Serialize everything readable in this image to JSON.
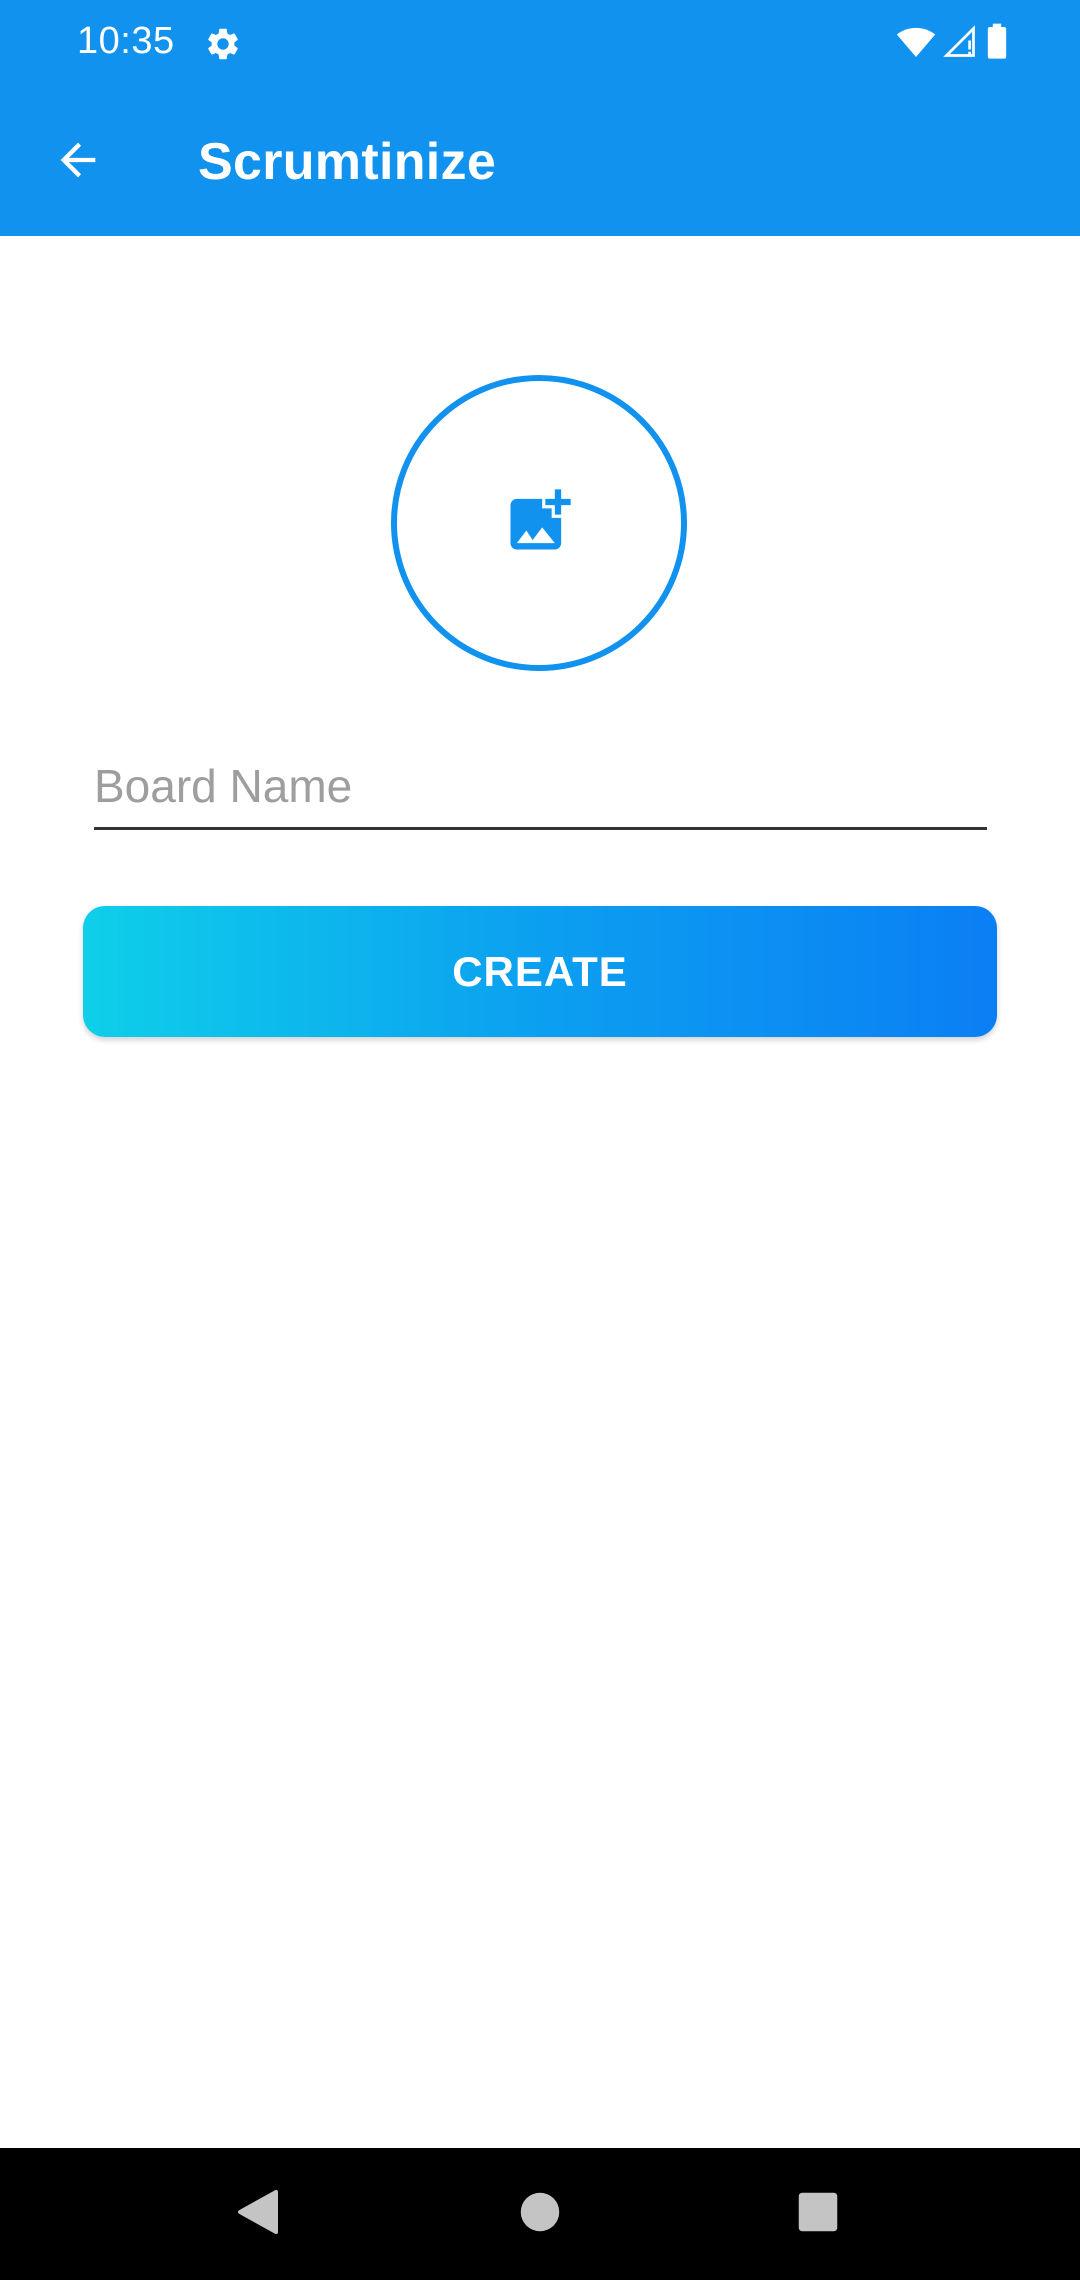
{
  "status_bar": {
    "time": "10:35",
    "icons": [
      "settings-gear-icon",
      "wifi-icon",
      "cell-signal-icon",
      "battery-icon"
    ]
  },
  "app_bar": {
    "title": "Scrumtinize",
    "back_icon": "arrow-back-icon"
  },
  "image_picker": {
    "icon": "add-photo-icon"
  },
  "form": {
    "board_name_placeholder": "Board Name",
    "board_name_value": ""
  },
  "create_button": {
    "label": "CREATE"
  },
  "nav_bar": {
    "icons": [
      "back-triangle-icon",
      "home-circle-icon",
      "recents-square-icon"
    ]
  },
  "colors": {
    "primary": "#1192EF",
    "gradient_start": "#0ECFE9",
    "gradient_end": "#0B7FF4"
  }
}
